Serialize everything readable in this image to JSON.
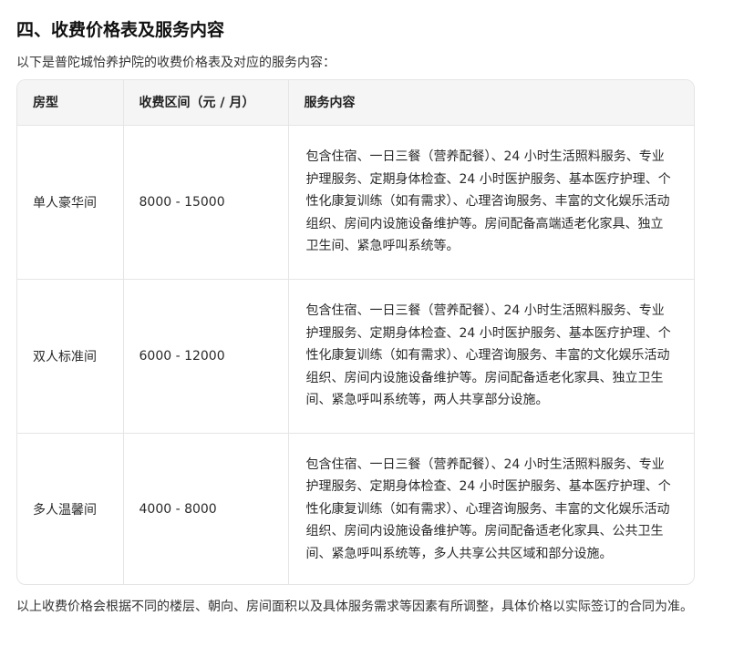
{
  "section": {
    "heading": "四、收费价格表及服务内容",
    "intro": "以下是普陀城怡养护院的收费价格表及对应的服务内容："
  },
  "table": {
    "headers": [
      "房型",
      "收费区间（元 / 月）",
      "服务内容"
    ],
    "rows": [
      {
        "room_type": "单人豪华间",
        "price_range": "8000 - 15000",
        "services": "包含住宿、一日三餐（营养配餐）、24 小时生活照料服务、专业护理服务、定期身体检查、24 小时医护服务、基本医疗护理、个性化康复训练（如有需求）、心理咨询服务、丰富的文化娱乐活动组织、房间内设施设备维护等。房间配备高端适老化家具、独立卫生间、紧急呼叫系统等。"
      },
      {
        "room_type": "双人标准间",
        "price_range": "6000 - 12000",
        "services": "包含住宿、一日三餐（营养配餐）、24 小时生活照料服务、专业护理服务、定期身体检查、24 小时医护服务、基本医疗护理、个性化康复训练（如有需求）、心理咨询服务、丰富的文化娱乐活动组织、房间内设施设备维护等。房间配备适老化家具、独立卫生间、紧急呼叫系统等，两人共享部分设施。"
      },
      {
        "room_type": "多人温馨间",
        "price_range": "4000 - 8000",
        "services": "包含住宿、一日三餐（营养配餐）、24 小时生活照料服务、专业护理服务、定期身体检查、24 小时医护服务、基本医疗护理、个性化康复训练（如有需求）、心理咨询服务、丰富的文化娱乐活动组织、房间内设施设备维护等。房间配备适老化家具、公共卫生间、紧急呼叫系统等，多人共享公共区域和部分设施。"
      }
    ]
  },
  "footer_note": "以上收费价格会根据不同的楼层、朝向、房间面积以及具体服务需求等因素有所调整，具体价格以实际签订的合同为准。"
}
